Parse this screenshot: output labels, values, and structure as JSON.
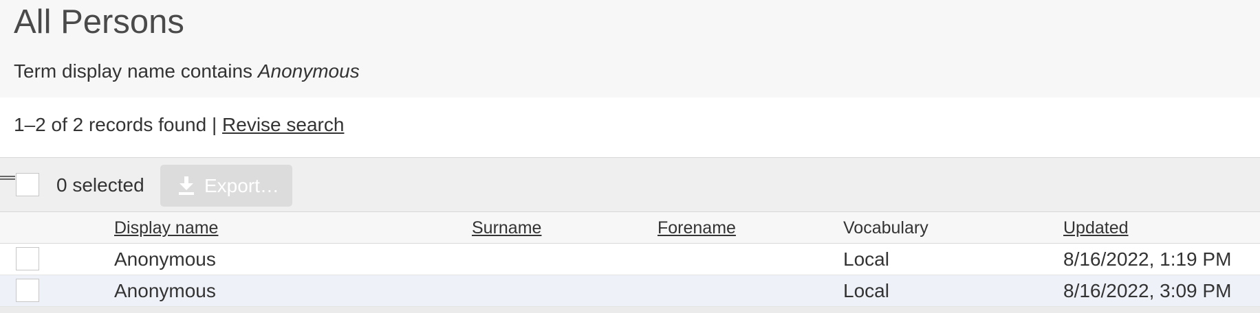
{
  "header": {
    "title": "All Persons",
    "search_desc_prefix": "Term display name contains",
    "search_desc_term": "Anonymous"
  },
  "results": {
    "count_text": "1–2 of 2 records found",
    "separator": "|",
    "revise_label": "Revise search"
  },
  "toolbar": {
    "selected_text": "0 selected",
    "export_label": "Export…",
    "export_icon": "download-icon"
  },
  "table": {
    "columns": [
      {
        "label": "Display name",
        "sortable": true
      },
      {
        "label": "Surname",
        "sortable": true
      },
      {
        "label": "Forename",
        "sortable": true
      },
      {
        "label": "Vocabulary",
        "sortable": false
      },
      {
        "label": "Updated",
        "sortable": true
      }
    ],
    "rows": [
      {
        "display_name": "Anonymous",
        "surname": "",
        "forename": "",
        "vocabulary": "Local",
        "updated": "8/16/2022, 1:19 PM"
      },
      {
        "display_name": "Anonymous",
        "surname": "",
        "forename": "",
        "vocabulary": "Local",
        "updated": "8/16/2022, 3:09 PM"
      }
    ]
  },
  "colors": {
    "header_bg": "#f7f7f7",
    "toolbar_bg": "#efefef",
    "alt_row_bg": "#eef2f8",
    "button_disabled_bg": "#dcdcdc"
  }
}
